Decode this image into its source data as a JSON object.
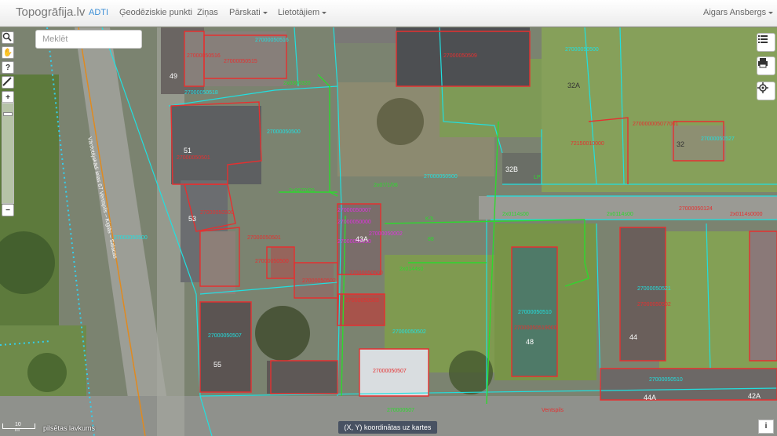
{
  "navbar": {
    "brand": "Topogrāfija.lv",
    "items": [
      "ADTI",
      "Ģeodēziskie punkti",
      "Ziņas",
      "Pārskati",
      "Lietotājiem"
    ],
    "user": "Aigars Ansbergs"
  },
  "search": {
    "placeholder": "Meklēt"
  },
  "map": {
    "house_numbers": [
      "49",
      "51",
      "53",
      "55",
      "43A",
      "48",
      "44",
      "44A",
      "42A",
      "32A",
      "32B",
      "32"
    ],
    "parcel_codes": [
      "27000050516",
      "27000050515",
      "27000050500",
      "27000050501",
      "27000050507",
      "27000050504",
      "27000050500",
      "27000050512",
      "27000050510",
      "27000050521",
      "27000050527",
      "27000050124",
      "27000050100",
      "27000050501"
    ],
    "labels": [
      "KJL",
      "LP"
    ],
    "roads": [
      "Vārdotājakādi ielas 67 Ventspils",
      "Ventspils"
    ],
    "scale_label": "10 m",
    "township": "pilsētas lavkums"
  },
  "bottom": {
    "coord_button": "(X, Y) koordinātas uz kartes",
    "info": "i"
  },
  "colors": {
    "parcel": "#e53030",
    "cadastre": "#20e0e0",
    "boundary": "#2ed82e",
    "accent": "#3b8ed6"
  }
}
